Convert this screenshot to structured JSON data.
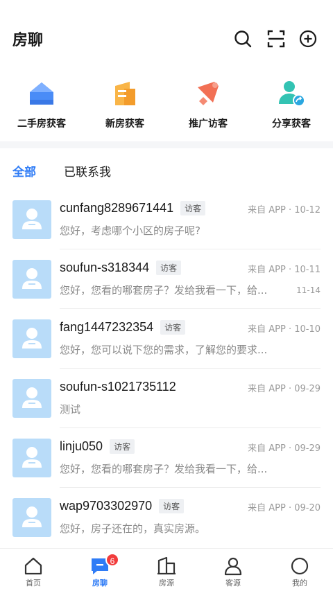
{
  "header": {
    "title": "房聊"
  },
  "quick_actions": [
    {
      "label": "二手房获客",
      "icon": "house-icon",
      "color": "#4a8cf7"
    },
    {
      "label": "新房获客",
      "icon": "building-icon",
      "color": "#f7a53b"
    },
    {
      "label": "推广访客",
      "icon": "megaphone-icon",
      "color": "#f27055"
    },
    {
      "label": "分享获客",
      "icon": "share-user-icon",
      "color": "#33c3b3"
    }
  ],
  "tabs": {
    "all": "全部",
    "contacted": "已联系我"
  },
  "conversations": [
    {
      "name": "cunfang8289671441",
      "tag": "访客",
      "meta": "来自 APP · 10-12",
      "message": "您好，考虑哪个小区的房子呢?",
      "sub_time": ""
    },
    {
      "name": "soufun-s318344",
      "tag": "访客",
      "meta": "来自 APP · 10-11",
      "message": "您好，您看的哪套房子？发给我看一下，给...",
      "sub_time": "11-14"
    },
    {
      "name": "fang1447232354",
      "tag": "访客",
      "meta": "来自 APP · 10-10",
      "message": "您好，您可以说下您的需求，了解您的要求...",
      "sub_time": ""
    },
    {
      "name": "soufun-s1021735112",
      "tag": "",
      "meta": "来自 APP · 09-29",
      "message": "测试",
      "sub_time": ""
    },
    {
      "name": "linju050",
      "tag": "访客",
      "meta": "来自 APP · 09-29",
      "message": "您好，您看的哪套房子？发给我看一下，给...",
      "sub_time": ""
    },
    {
      "name": "wap9703302970",
      "tag": "访客",
      "meta": "来自 APP · 09-20",
      "message": "您好，房子还在的，真实房源。",
      "sub_time": ""
    }
  ],
  "bottom_nav": [
    {
      "label": "首页",
      "icon": "home-icon",
      "active": false
    },
    {
      "label": "房聊",
      "icon": "chat-icon",
      "active": true,
      "badge": "6"
    },
    {
      "label": "房源",
      "icon": "property-icon",
      "active": false
    },
    {
      "label": "客源",
      "icon": "client-icon",
      "active": false
    },
    {
      "label": "我的",
      "icon": "profile-icon",
      "active": false
    }
  ],
  "colors": {
    "accent": "#2f7cf6",
    "badge": "#f23c3c",
    "avatar_bg": "#b9dcf9"
  }
}
